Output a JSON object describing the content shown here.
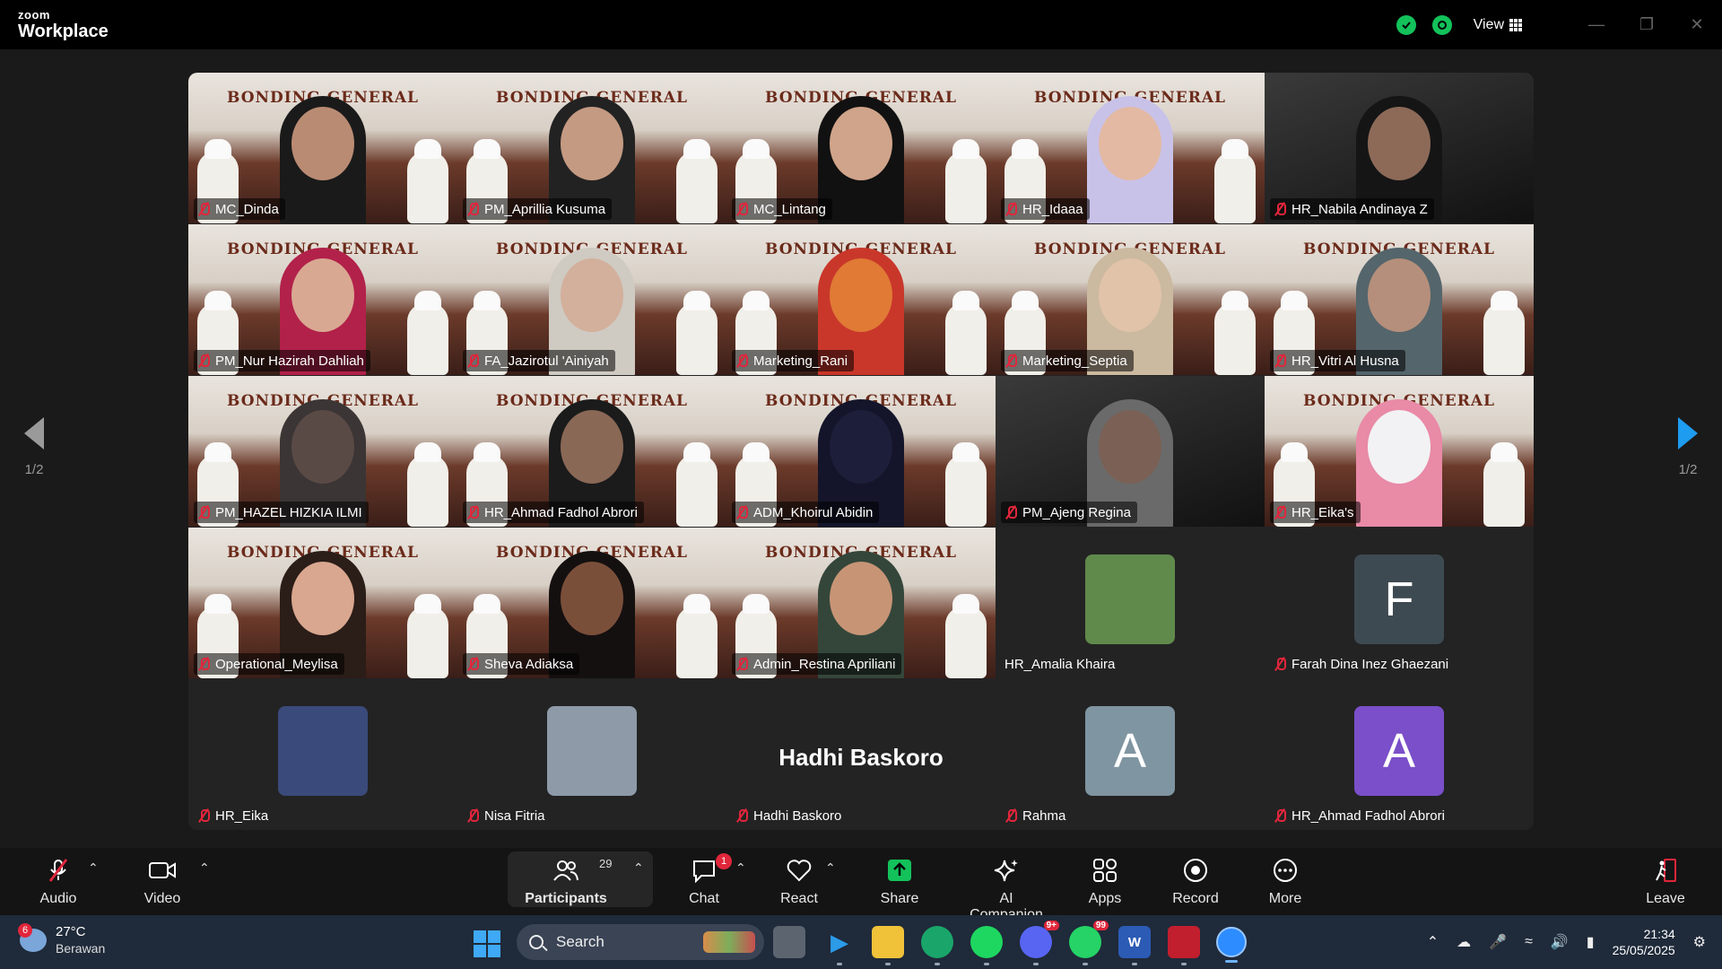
{
  "titlebar": {
    "brand_small": "zoom",
    "brand_big": "Workplace",
    "view_label": "View"
  },
  "gallery": {
    "page_left": "1/2",
    "page_right": "1/2",
    "banner_title": "BONDING GENERAL",
    "tiles": [
      {
        "name": "MC_Dinda",
        "type": "banner",
        "skin": "#b98b73",
        "hijab": "#1a1a1a"
      },
      {
        "name": "PM_Aprillia Kusuma",
        "type": "banner",
        "skin": "#c49a82",
        "hijab": "#222"
      },
      {
        "name": "MC_Lintang",
        "type": "banner",
        "skin": "#d0a48a",
        "hijab": "#111"
      },
      {
        "name": "HR_Idaaa",
        "type": "banner",
        "skin": "#e3b9a3",
        "hijab": "#c9c2e8"
      },
      {
        "name": "HR_Nabila Andinaya Z",
        "type": "dark",
        "skin": "#8d6a58",
        "hijab": "#151515"
      },
      {
        "name": "PM_Nur Hazirah Dahliah",
        "type": "banner",
        "skin": "#d9a892",
        "hijab": "#b2214a"
      },
      {
        "name": "FA_Jazirotul 'Ainiyah",
        "type": "banner",
        "skin": "#d3b09c",
        "hijab": "#cfcac2"
      },
      {
        "name": "Marketing_Rani",
        "type": "banner",
        "skin": "#e07a35",
        "hijab": "#c9372a"
      },
      {
        "name": "Marketing_Septia",
        "type": "banner",
        "skin": "#e0c3a8",
        "hijab": "#cbb9a0"
      },
      {
        "name": "HR_Vitri Al Husna",
        "type": "banner",
        "skin": "#b58f7b",
        "hijab": "#54656b"
      },
      {
        "name": "PM_HAZEL HIZKIA ILMI",
        "type": "banner",
        "skin": "#5a4a45",
        "hijab": "#3b3535"
      },
      {
        "name": "HR_Ahmad Fadhol Abrori",
        "type": "banner",
        "skin": "#8a6856",
        "hijab": "#1b1b1b"
      },
      {
        "name": "ADM_Khoirul Abidin",
        "type": "banner",
        "skin": "#1d1f3a",
        "hijab": "#14152a"
      },
      {
        "name": "PM_Ajeng Regina",
        "type": "dark",
        "skin": "#7a6055",
        "hijab": "#6a6a6a"
      },
      {
        "name": "HR_Eika's",
        "type": "banner",
        "skin": "#f2f2f4",
        "hijab": "#e98aa6"
      },
      {
        "name": "Operational_Meylisa",
        "type": "banner",
        "skin": "#d9a78f",
        "hijab": "#2b1d18"
      },
      {
        "name": "Sheva Adiaksa",
        "type": "banner",
        "skin": "#7a4f3a",
        "hijab": "#151010"
      },
      {
        "name": "Admin_Restina Apriliani",
        "type": "banner",
        "skin": "#c79476",
        "hijab": "#34463a"
      },
      {
        "name": "HR_Amalia Khaira",
        "type": "avatar-photo",
        "avatar_color": "#5f8a4c"
      },
      {
        "name": "Farah Dina Inez Ghaezani",
        "type": "avatar-letter",
        "letter": "F",
        "avatar_color": "#3e4a52"
      },
      {
        "name": "HR_Eika",
        "type": "avatar-photo",
        "avatar_color": "#3a4a7a"
      },
      {
        "name": "Nisa Fitria",
        "type": "avatar-photo",
        "avatar_color": "#8e9aa8"
      },
      {
        "name": "Hadhi Baskoro",
        "type": "bigname",
        "display": "Hadhi Baskoro"
      },
      {
        "name": "Rahma",
        "type": "avatar-letter",
        "letter": "A",
        "avatar_color": "#7f95a1"
      },
      {
        "name": "HR_Ahmad Fadhol Abrori",
        "type": "avatar-letter",
        "letter": "A",
        "avatar_color": "#7a4fc9"
      }
    ]
  },
  "toolbar": {
    "audio": "Audio",
    "video": "Video",
    "participants": "Participants",
    "participants_count": "29",
    "chat": "Chat",
    "chat_badge": "1",
    "react": "React",
    "share": "Share",
    "ai_companion": "AI Companion",
    "apps": "Apps",
    "record": "Record",
    "more": "More",
    "leave": "Leave"
  },
  "taskbar": {
    "weather_badge": "6",
    "temperature": "27°C",
    "weather_desc": "Berawan",
    "search_label": "Search",
    "discord_badge": "9+",
    "whatsapp_badge": "99",
    "time": "21:34",
    "date": "25/05/2025"
  },
  "colors": {
    "active_speaker": "#2bd68a",
    "share_green": "#13c25a",
    "mute_red": "#e0263b",
    "nav_blue": "#1e9cf0"
  }
}
